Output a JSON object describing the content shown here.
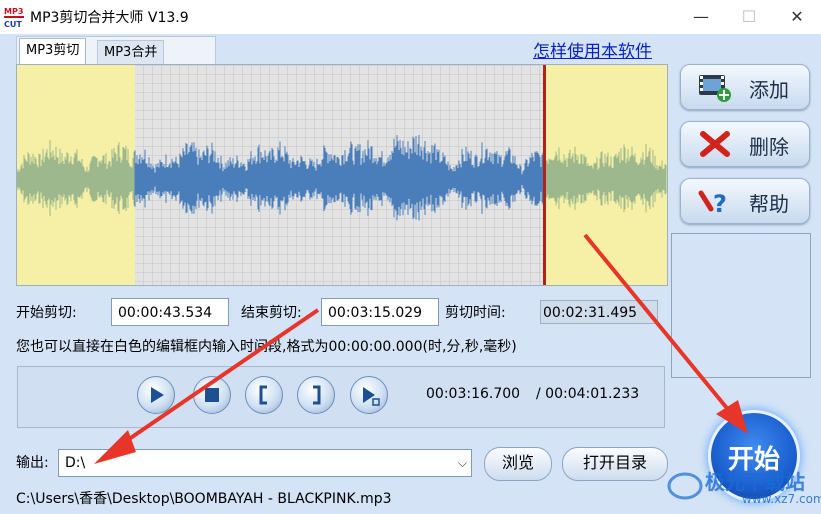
{
  "window": {
    "title": "MP3剪切合并大师 V13.9",
    "app_icon_text": [
      "MP3",
      "CUT"
    ]
  },
  "tabs": [
    {
      "label": "MP3剪切",
      "active": true
    },
    {
      "label": "MP3合并",
      "active": false
    }
  ],
  "help_link": "怎样使用本软件",
  "side_buttons": {
    "add": {
      "label": "添加",
      "icon": "add-media-icon"
    },
    "delete": {
      "label": "删除",
      "icon": "red-x-icon"
    },
    "help": {
      "label": "帮助",
      "icon": "help-question-icon"
    }
  },
  "cut": {
    "start_label": "开始剪切:",
    "start_value": "00:00:43.534",
    "end_label": "结束剪切:",
    "end_value": "00:03:15.029",
    "duration_label": "剪切时间:",
    "duration_value": "00:02:31.495",
    "hint": "您也可以直接在白色的编辑框内输入时间段,格式为00:00:00.000(时,分,秒,毫秒)"
  },
  "player": {
    "buttons": [
      "play-icon",
      "stop-icon",
      "mark-start-icon",
      "mark-end-icon",
      "play-selection-icon"
    ],
    "current_time": "00:03:16.700",
    "total_time": "/ 00:04:01.233"
  },
  "output": {
    "label": "输出:",
    "value": "D:\\",
    "browse_label": "浏览",
    "open_dir_label": "打开目录"
  },
  "file_path": "C:\\Users\\香香\\Desktop\\BOOMBAYAH - BLACKPINK.mp3",
  "start_button": "开始",
  "watermark": {
    "text": "极光下载站",
    "url": "www.xz7.com"
  },
  "colors": {
    "accent": "#1b5fcf",
    "wave_selected": "#4a7ebb",
    "wave_unselected": "#9db88c",
    "region_unselected": "#f5f0a6",
    "cursor": "#b0241a",
    "arrow": "#e8352a"
  }
}
